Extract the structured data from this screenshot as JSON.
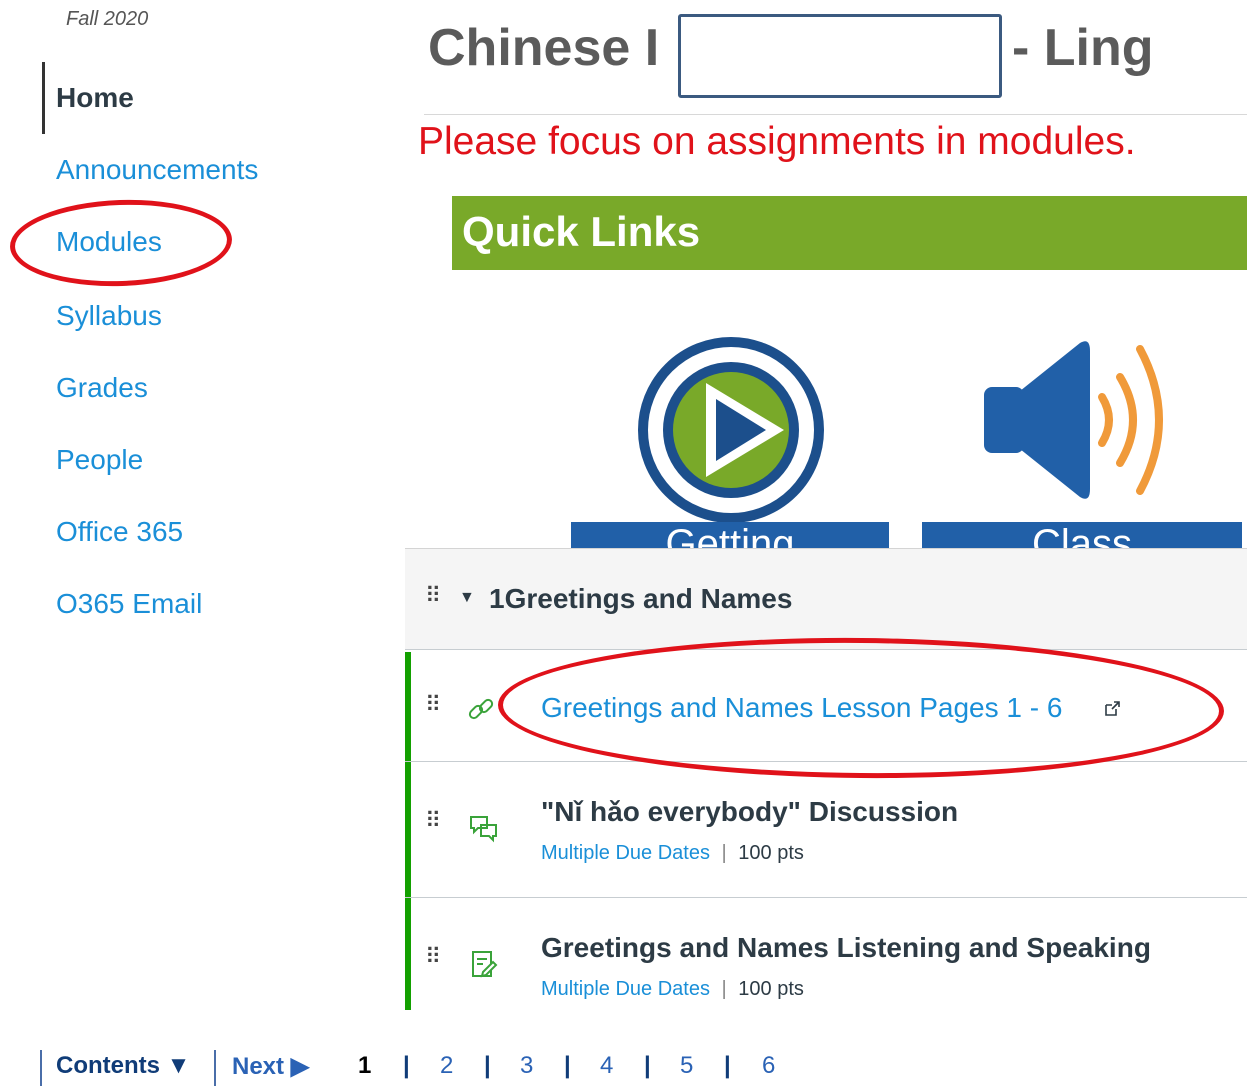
{
  "sidebar": {
    "term": "Fall 2020",
    "items": [
      {
        "label": "Home"
      },
      {
        "label": "Announcements"
      },
      {
        "label": "Modules"
      },
      {
        "label": "Syllabus"
      },
      {
        "label": "Grades"
      },
      {
        "label": "People"
      },
      {
        "label": "Office 365"
      },
      {
        "label": "O365 Email"
      }
    ]
  },
  "header": {
    "title_prefix": "Chinese I",
    "title_suffix": "- Ling",
    "notice": "Please focus on assignments in modules."
  },
  "quick_links": {
    "heading": "Quick Links",
    "buttons": [
      {
        "label": "Getting"
      },
      {
        "label": "Class"
      }
    ]
  },
  "module": {
    "title": "1Greetings and Names",
    "items": [
      {
        "title": "Greetings and Names Lesson Pages 1 - 6",
        "type": "external-link",
        "icon": "link-icon"
      },
      {
        "title": "\"Nǐ hǎo everybody\" Discussion",
        "type": "discussion",
        "icon": "discussion-icon",
        "due": "Multiple Due Dates",
        "points": "100 pts"
      },
      {
        "title": "Greetings and Names Listening and Speaking",
        "type": "assignment",
        "icon": "assignment-icon",
        "due": "Multiple Due Dates",
        "points": "100 pts"
      }
    ],
    "separator": "|"
  },
  "footer": {
    "contents_label": "Contents ▼",
    "next_label": "Next ▶",
    "pages": [
      "1",
      "2",
      "3",
      "4",
      "5",
      "6"
    ],
    "current_page": "1"
  },
  "colors": {
    "link": "#1a8fd8",
    "quick_links_bg": "#79a929",
    "notice": "#e0121a",
    "completion_bar": "#13a000"
  }
}
